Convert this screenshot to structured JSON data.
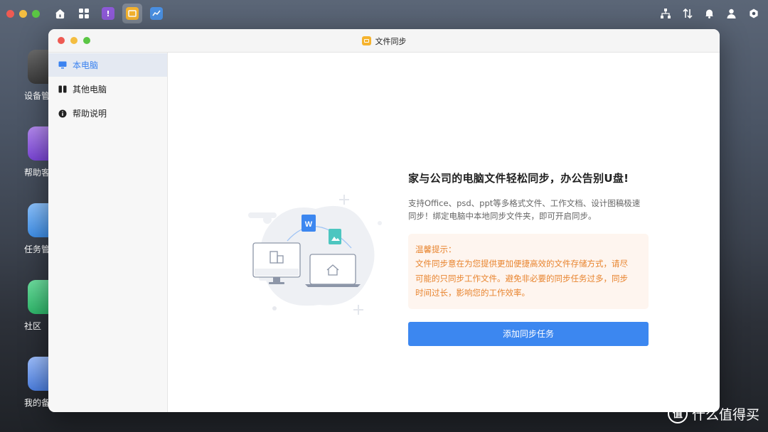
{
  "window": {
    "title": "文件同步"
  },
  "sidebar": {
    "items": [
      {
        "label": "本电脑",
        "active": true,
        "icon": "monitor-icon"
      },
      {
        "label": "其他电脑",
        "active": false,
        "icon": "devices-icon"
      },
      {
        "label": "帮助说明",
        "active": false,
        "icon": "info-icon"
      }
    ]
  },
  "main": {
    "headline": "家与公司的电脑文件轻松同步，办公告别U盘!",
    "description_lines": [
      "支持Office、psd、ppt等多格式文件、工作文档、设计图稿极速",
      "同步！绑定电脑中本地同步文件夹，即可开启同步。"
    ],
    "tip": {
      "title": "温馨提示：",
      "lines": [
        "文件同步意在为您提供更加便捷高效的文件存储方式，请尽",
        "可能的只同步工作文件。避免非必要的同步任务过多，同步",
        "时间过长，影响您的工作效率。"
      ]
    },
    "add_button_label": "添加同步任务"
  },
  "desktop": {
    "icons": [
      {
        "label": "设备管",
        "icon": "device-manager-icon"
      },
      {
        "label": "帮助客",
        "icon": "help-center-icon"
      },
      {
        "label": "任务管",
        "icon": "task-manager-icon"
      },
      {
        "label": "社区",
        "icon": "community-icon"
      },
      {
        "label": "我的备",
        "icon": "backup-icon"
      }
    ]
  },
  "watermark": {
    "symbol": "值",
    "text": "什么值得买"
  },
  "colors": {
    "accent": "#3c87f0",
    "tip_text": "#e8842e",
    "tip_bg": "#fef5ef",
    "sidebar_active_bg": "#e4e9f2"
  }
}
